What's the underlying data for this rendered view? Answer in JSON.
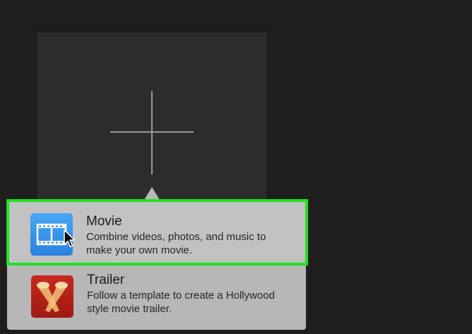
{
  "project_picker": {
    "new_project_icon": "plus-icon"
  },
  "menu": {
    "items": [
      {
        "title": "Movie",
        "description_line1": "Combine videos, photos, and music to",
        "description_line2": "make your own movie.",
        "icon": "film-strip-icon",
        "selected": true
      },
      {
        "title": "Trailer",
        "description_line1": "Follow a template to create a Hollywood",
        "description_line2": "style movie trailer.",
        "icon": "spotlights-icon",
        "selected": false
      }
    ]
  },
  "colors": {
    "highlight": "#22e022",
    "movie_icon": "#2b82de",
    "trailer_icon": "#9e1a12",
    "popover": "#b7b7b7",
    "background": "#1e1e1e"
  }
}
